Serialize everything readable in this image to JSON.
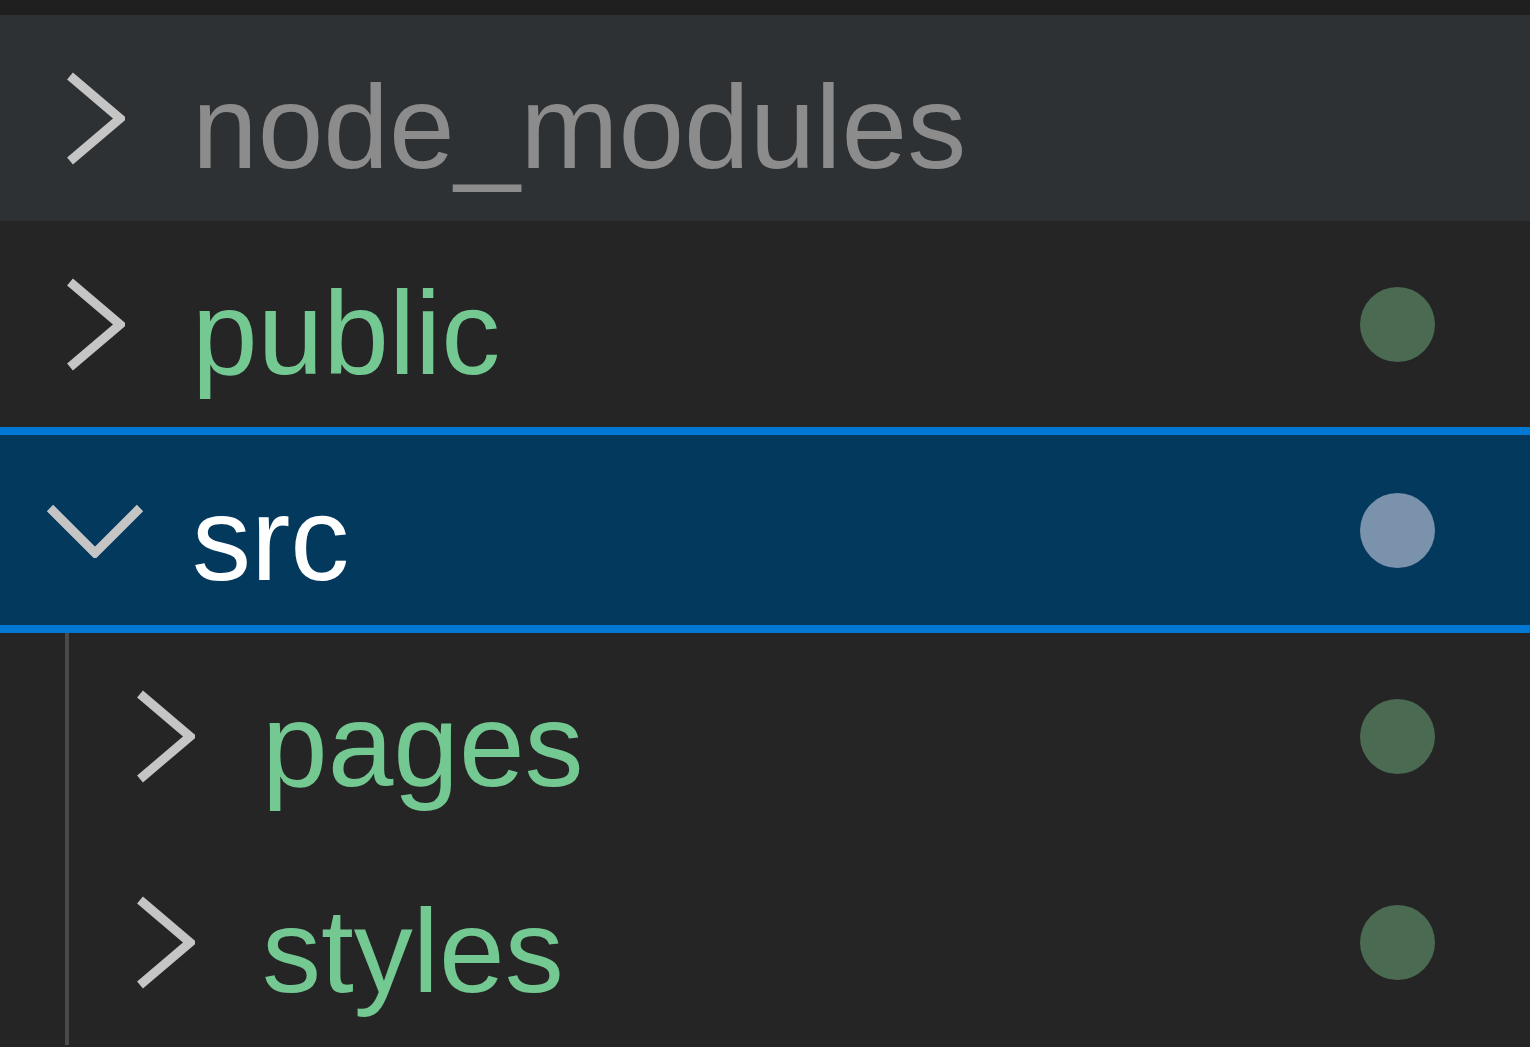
{
  "explorer": {
    "tree": [
      {
        "name": "node_modules",
        "expanded": false,
        "selected": false,
        "hovered": true,
        "ignored": true
      },
      {
        "name": "public",
        "expanded": false,
        "selected": false,
        "hovered": false,
        "ignored": false,
        "color": "#4b6a52"
      },
      {
        "name": "src",
        "expanded": true,
        "selected": true,
        "hovered": false,
        "ignored": false,
        "color": "#7a92ab",
        "children": [
          {
            "name": "pages",
            "expanded": false,
            "selected": false,
            "hovered": false,
            "ignored": false,
            "color": "#4b6a52"
          },
          {
            "name": "styles",
            "expanded": false,
            "selected": false,
            "hovered": false,
            "ignored": false,
            "color": "#4b6a52"
          }
        ]
      }
    ]
  }
}
